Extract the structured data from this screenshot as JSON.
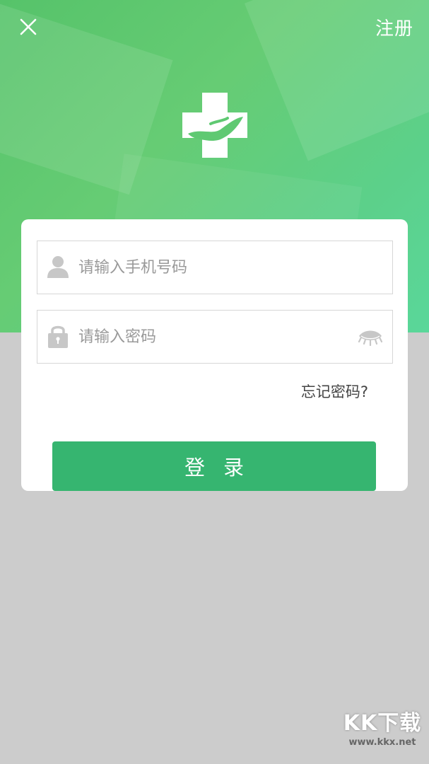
{
  "header": {
    "close_icon": "close-icon",
    "register_label": "注册"
  },
  "logo": {
    "icon": "medical-cross-hand-icon"
  },
  "form": {
    "phone_placeholder": "请输入手机号码",
    "phone_value": "",
    "password_placeholder": "请输入密码",
    "password_value": "",
    "forgot_label": "忘记密码?",
    "login_label": "登录"
  },
  "watermark": {
    "brand": "KK下载",
    "url": "www.kkx.net"
  },
  "colors": {
    "hero_green": "#5dc872",
    "button_green": "#36b570",
    "background_gray": "#cccccc"
  }
}
